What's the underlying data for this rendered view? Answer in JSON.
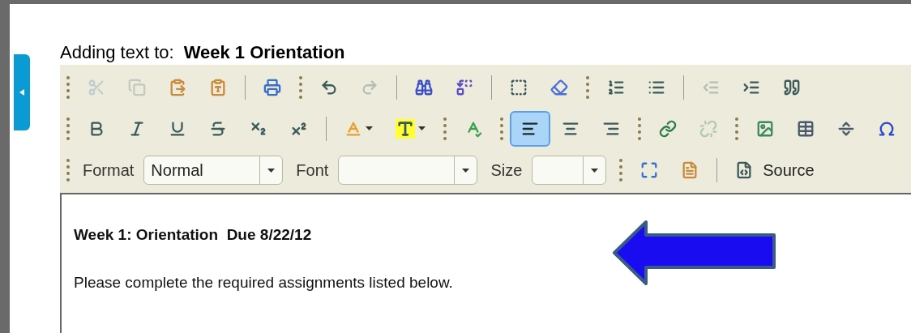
{
  "heading": {
    "label": "Adding text to:",
    "target": "Week 1 Orientation"
  },
  "toolbar": {
    "rows": [
      [
        {
          "grip": true,
          "items": [
            {
              "kind": "cut",
              "disabled": true
            },
            {
              "kind": "copy",
              "disabled": true
            },
            {
              "kind": "paste",
              "disabled": false
            },
            {
              "kind": "paste-word",
              "disabled": false
            }
          ]
        },
        {
          "grip": false,
          "items": [
            {
              "kind": "print",
              "disabled": false
            }
          ]
        },
        {
          "grip": true,
          "items": [
            {
              "kind": "undo",
              "disabled": false
            },
            {
              "kind": "redo",
              "disabled": true
            }
          ]
        },
        {
          "grip": false,
          "items": [
            {
              "kind": "find",
              "disabled": false
            },
            {
              "kind": "replace",
              "disabled": false
            }
          ]
        },
        {
          "grip": false,
          "items": [
            {
              "kind": "select-all",
              "disabled": false
            },
            {
              "kind": "eraser",
              "disabled": false
            }
          ]
        },
        {
          "grip": true,
          "items": [
            {
              "kind": "numbered-list",
              "disabled": false
            },
            {
              "kind": "bulleted-list",
              "disabled": false
            }
          ]
        },
        {
          "grip": false,
          "items": [
            {
              "kind": "outdent",
              "disabled": true
            },
            {
              "kind": "indent",
              "disabled": false
            },
            {
              "kind": "quote",
              "disabled": false
            }
          ]
        }
      ],
      [
        {
          "grip": true,
          "items": [
            {
              "kind": "bold",
              "disabled": false
            },
            {
              "kind": "italic",
              "disabled": false
            },
            {
              "kind": "underline",
              "disabled": false
            },
            {
              "kind": "strikethrough",
              "disabled": false
            },
            {
              "kind": "subscript",
              "disabled": false
            },
            {
              "kind": "superscript",
              "disabled": false
            }
          ]
        },
        {
          "grip": false,
          "items": [
            {
              "kind": "text-color",
              "disabled": false
            },
            {
              "kind": "background-color",
              "disabled": false
            }
          ]
        },
        {
          "grip": true,
          "items": [
            {
              "kind": "spellcheck",
              "disabled": false
            }
          ]
        },
        {
          "grip": true,
          "items": [
            {
              "kind": "align-left",
              "disabled": false,
              "selected": true
            },
            {
              "kind": "align-center",
              "disabled": false,
              "selected": false
            },
            {
              "kind": "align-right",
              "disabled": false,
              "selected": false
            }
          ]
        },
        {
          "grip": true,
          "items": [
            {
              "kind": "link",
              "disabled": false
            },
            {
              "kind": "unlink",
              "disabled": true
            }
          ]
        },
        {
          "grip": true,
          "items": [
            {
              "kind": "image",
              "disabled": false
            },
            {
              "kind": "table",
              "disabled": false
            },
            {
              "kind": "horizontal-rule",
              "disabled": false
            },
            {
              "kind": "special-character",
              "disabled": false
            }
          ]
        }
      ],
      [
        {
          "grip": true,
          "items": [
            {
              "kind": "combo",
              "label": "Format",
              "value": "Normal"
            },
            {
              "kind": "combo",
              "label": "Font"
            },
            {
              "kind": "combo",
              "label": "Size"
            }
          ]
        },
        {
          "grip": true,
          "items": [
            {
              "kind": "maximize",
              "disabled": false
            },
            {
              "kind": "show-blocks",
              "disabled": false
            }
          ]
        },
        {
          "grip": false,
          "items": [
            {
              "kind": "source",
              "label": "Source",
              "disabled": false
            }
          ]
        }
      ]
    ]
  },
  "content": {
    "title": "Week 1: Orientation  Due 8/22/12",
    "paragraph": "Please complete the required assignments listed below."
  }
}
